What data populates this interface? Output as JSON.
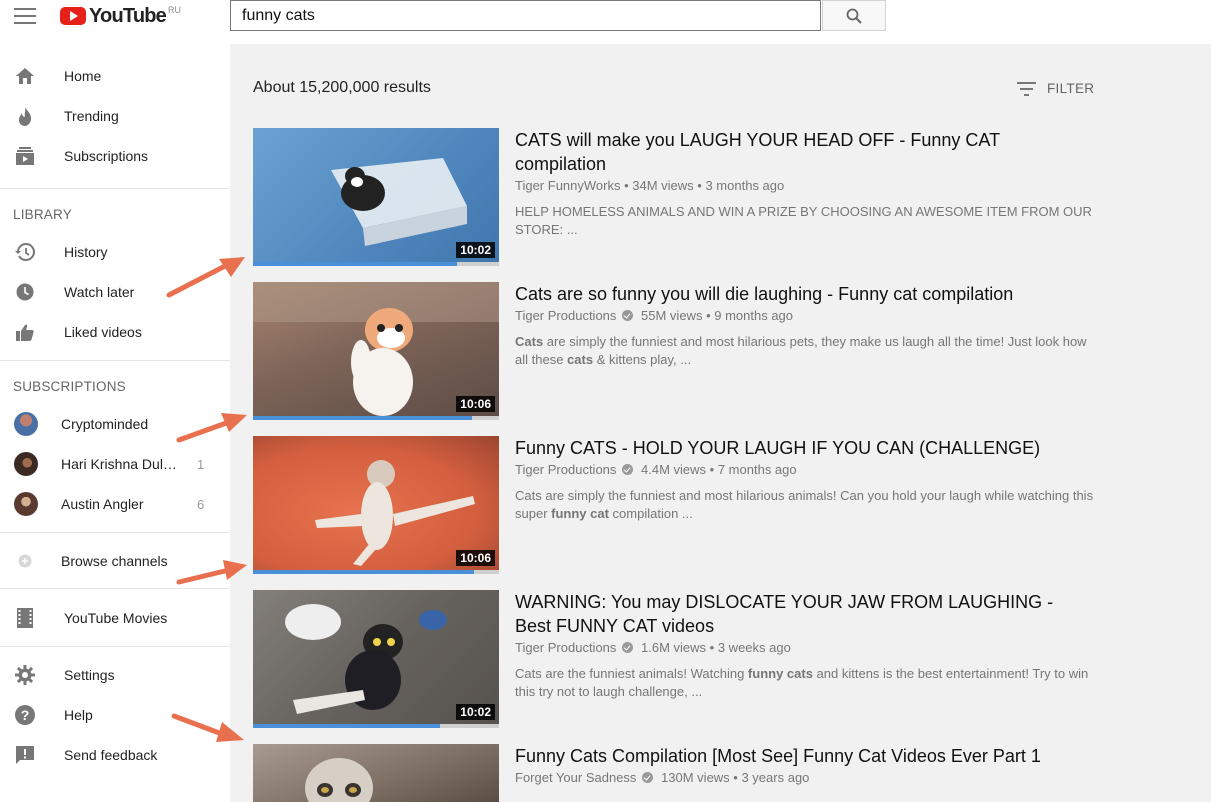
{
  "header": {
    "logo_text": "YouTube",
    "logo_region": "RU",
    "search_value": "funny cats"
  },
  "sidebar": {
    "main": [
      {
        "label": "Home",
        "icon": "home-icon"
      },
      {
        "label": "Trending",
        "icon": "flame-icon"
      },
      {
        "label": "Subscriptions",
        "icon": "subscriptions-icon"
      }
    ],
    "library_heading": "LIBRARY",
    "library": [
      {
        "label": "History",
        "icon": "history-icon"
      },
      {
        "label": "Watch later",
        "icon": "clock-icon"
      },
      {
        "label": "Liked videos",
        "icon": "thumbs-up-icon"
      }
    ],
    "subscriptions_heading": "SUBSCRIPTIONS",
    "subscriptions": [
      {
        "label": "Cryptominded",
        "count": ""
      },
      {
        "label": "Hari Krishna Dul…",
        "count": "1"
      },
      {
        "label": "Austin Angler",
        "count": "6"
      }
    ],
    "browse_channels": "Browse channels",
    "youtube_movies": "YouTube Movies",
    "footer": [
      {
        "label": "Settings",
        "icon": "gear-icon"
      },
      {
        "label": "Help",
        "icon": "help-icon"
      },
      {
        "label": "Send feedback",
        "icon": "feedback-icon"
      }
    ]
  },
  "results": {
    "count_text": "About 15,200,000 results",
    "filter_label": "FILTER"
  },
  "videos": [
    {
      "title_line1": "CATS will make you LAUGH YOUR HEAD OFF - Funny CAT",
      "title_line2": "compilation",
      "channel": "Tiger FunnyWorks",
      "verified": false,
      "views": "34M views",
      "age": "3 months ago",
      "desc_line1": "HELP HOMELESS ANIMALS AND WIN A PRIZE BY CHOOSING AN AWESOME ITEM FROM OUR",
      "desc_line2": "STORE: ...",
      "duration": "10:02",
      "progress": 0.83,
      "thumb_color": "#5b93c3"
    },
    {
      "title_line1": "Cats are so funny you will die laughing - Funny cat compilation",
      "title_line2": "",
      "channel": "Tiger Productions",
      "verified": true,
      "views": "55M views",
      "age": "9 months ago",
      "desc_line1_bold": "Cats",
      "desc_line1_rest": " are simply the funniest and most hilarious pets, they make us laugh all the time! Just look how",
      "desc_line2_pre": "all these ",
      "desc_line2_bold": "cats",
      "desc_line2_post": " & kittens play, ...",
      "duration": "10:06",
      "progress": 0.89,
      "thumb_color": "#8a6a5a"
    },
    {
      "title_line1": "Funny CATS - HOLD YOUR LAUGH IF YOU CAN (CHALLENGE)",
      "title_line2": "",
      "channel": "Tiger Productions",
      "verified": true,
      "views": "4.4M views",
      "age": "7 months ago",
      "desc_line1": "Cats are simply the funniest and most hilarious animals! Can you hold your laugh while watching this",
      "desc_line2_pre": "super ",
      "desc_line2_bold": "funny cat",
      "desc_line2_post": " compilation ...",
      "duration": "10:06",
      "progress": 0.9,
      "thumb_color": "#d9684a"
    },
    {
      "title_line1": "WARNING: You may DISLOCATE YOUR JAW FROM LAUGHING -",
      "title_line2": "Best FUNNY CAT videos",
      "channel": "Tiger Productions",
      "verified": true,
      "views": "1.6M views",
      "age": "3 weeks ago",
      "desc_line1_pre": "Cats are the funniest animals! Watching ",
      "desc_line1_bold": "funny cats",
      "desc_line1_post": " and kittens is the best entertainment! Try to win",
      "desc_line2": "this try not to laugh challenge, ...",
      "duration": "10:02",
      "progress": 0.76,
      "thumb_color": "#6e6a66"
    },
    {
      "title_line1": "Funny Cats Compilation [Most See] Funny Cat Videos Ever Part 1",
      "title_line2": "",
      "channel": "Forget Your Sadness",
      "verified": true,
      "views": "130M views",
      "age": "3 years ago",
      "duration": "",
      "thumb_color": "#8a7d72"
    }
  ],
  "colors": {
    "accent_red": "#e62117",
    "arrow": "#e8704e",
    "progress_blue": "#4a90d9"
  }
}
